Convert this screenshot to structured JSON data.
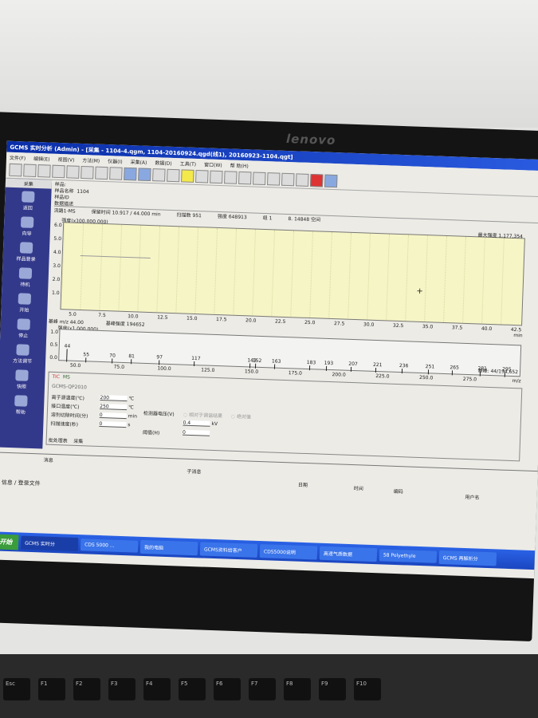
{
  "monitor": {
    "brand": "lenovo"
  },
  "window": {
    "title": "GCMS 实时分析 (Admin) - [采集 - 1104-4.qgm, 1104-20160924.qgd(线1), 20160923-1104.qgt]"
  },
  "menu": [
    "文件(F)",
    "编辑(E)",
    "视图(V)",
    "方法(M)",
    "仪器(I)",
    "采集(A)",
    "数据(D)",
    "工具(T)",
    "窗口(W)",
    "帮 助(H)"
  ],
  "sidebar": {
    "header": "采集",
    "items": [
      "返回",
      "向导",
      "样品登录",
      "待机",
      "开始",
      "停止",
      "方法调节",
      "快照",
      "帮助"
    ]
  },
  "info": {
    "sample": "样品:",
    "sample_name_label": "样品名称",
    "sample_name": "1104",
    "sample_id_label": "样品ID",
    "desc_label": "数据描述"
  },
  "status": {
    "line": "流路1-MS",
    "rt": "保留时间  10.917 / 44.000 min",
    "scan": "扫描数  951",
    "intensity": "强度  648913",
    "group": "组  1",
    "space": "8.  14848 空间"
  },
  "tic": {
    "ylabel": "强度(x100,000,000)",
    "yticks": [
      "6.0",
      "5.0",
      "4.0",
      "3.0",
      "2.0",
      "1.0"
    ],
    "xticks": [
      "5.0",
      "7.5",
      "10.0",
      "12.5",
      "15.0",
      "17.5",
      "20.0",
      "22.5",
      "25.0",
      "27.5",
      "30.0",
      "32.5",
      "35.0",
      "37.5",
      "40.0",
      "42.5"
    ],
    "xunit": "min",
    "max_label": "最大强度  1,177,354"
  },
  "basepeak": {
    "mz": "基峰 m/z  44.00",
    "intensity": "基峰强度  194652"
  },
  "ms": {
    "ylabel": "强度(x1,000,000)",
    "yticks": [
      "1.0",
      "0.5",
      "0.0"
    ],
    "peaks": [
      "44",
      "55",
      "70",
      "81",
      "97",
      "117",
      "149",
      "152",
      "163",
      "183",
      "193",
      "207",
      "221",
      "236",
      "251",
      "265",
      "281",
      "295"
    ],
    "xticks": [
      "50.0",
      "75.0",
      "100.0",
      "125.0",
      "150.0",
      "175.0",
      "200.0",
      "225.0",
      "250.0",
      "275.0"
    ],
    "xunit": "m/z",
    "basepeak": "基峰:  44/194,652"
  },
  "params": {
    "tabs": [
      "TIC",
      "MS"
    ],
    "instrument": "GCMS-QP2010",
    "ion_temp_label": "离子源温度(℃)",
    "ion_temp": "200",
    "iface_temp_label": "接口温度(℃)",
    "iface_temp": "250",
    "solvent_label": "溶剂切除时间(分)",
    "solvent": "0",
    "scan_speed_label": "扫描速度(秒)",
    "scan_speed": "0",
    "unit_c": "℃",
    "unit_min": "min",
    "unit_s": "s",
    "detector_label": "检测器电压(V)",
    "radio_rel": "相对于调谐结果",
    "radio_abs": "绝对值",
    "voltage": "0.4",
    "unit_kv": "kV",
    "threshold_label": "阈值(H)",
    "threshold": "0"
  },
  "bottom_tabs": [
    "批处理表",
    "采集"
  ],
  "messages": {
    "columns": [
      "消息",
      "子消息",
      "日期",
      "时间",
      "编码",
      "用户名"
    ],
    "tabs": [
      "信息",
      "登录文件"
    ]
  },
  "taskbar": {
    "start": "开始",
    "items": [
      "GCMS 实时分",
      "CDS 5000 ...",
      "我的电脑",
      "GCMS资料给客户",
      "CDS5000说明",
      "高速气质数据",
      "58 Polyethyle",
      "GCMS 再解析分"
    ]
  },
  "keyboard": {
    "keys": [
      "Esc",
      "F1",
      "F2",
      "F3",
      "F4",
      "F5",
      "F6",
      "F7",
      "F8",
      "F9",
      "F10"
    ]
  }
}
